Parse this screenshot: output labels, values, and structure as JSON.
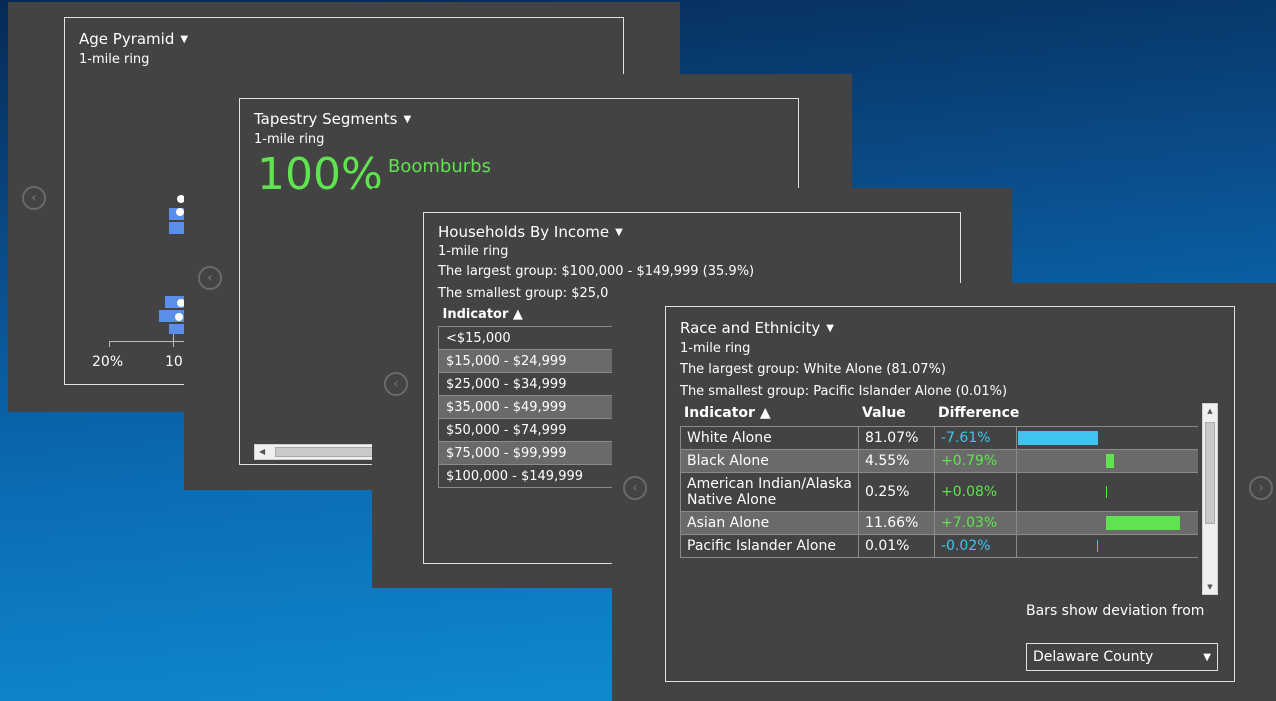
{
  "age_pyramid": {
    "title": "Age Pyramid",
    "subtitle": "1-mile ring",
    "axis_ticks": [
      "20%",
      "10"
    ]
  },
  "tapestry": {
    "title": "Tapestry Segments",
    "subtitle": "1-mile ring",
    "percent": "100%",
    "segment": "Boomburbs"
  },
  "income": {
    "title": "Households By Income",
    "subtitle": "1-mile ring",
    "largest": "The largest group: $100,000 - $149,999 (35.9%)",
    "smallest": "The smallest group: $25,0",
    "header_indicator": "Indicator ▲",
    "rows": [
      "<$15,000",
      "$15,000 - $24,999",
      "$25,000 - $34,999",
      "$35,000 - $49,999",
      "$50,000 - $74,999",
      "$75,000 - $99,999",
      "$100,000 - $149,999"
    ]
  },
  "race": {
    "title": "Race and Ethnicity",
    "subtitle": "1-mile ring",
    "largest": "The largest group: White Alone (81.07%)",
    "smallest": "The smallest group: Pacific Islander Alone (0.01%)",
    "headers": {
      "indicator": "Indicator ▲",
      "value": "Value",
      "difference": "Difference"
    },
    "rows": [
      {
        "indicator": "White Alone",
        "value": "81.07%",
        "difference": "-7.61%",
        "deviation": -7.61
      },
      {
        "indicator": "Black Alone",
        "value": "4.55%",
        "difference": "+0.79%",
        "deviation": 0.79
      },
      {
        "indicator": "American Indian/Alaska Native Alone",
        "value": "0.25%",
        "difference": "+0.08%",
        "deviation": 0.08
      },
      {
        "indicator": "Asian Alone",
        "value": "11.66%",
        "difference": "+7.03%",
        "deviation": 7.03
      },
      {
        "indicator": "Pacific Islander Alone",
        "value": "0.01%",
        "difference": "-0.02%",
        "deviation": -0.02
      }
    ],
    "deviation_label": "Bars show deviation from",
    "deviation_select": "Delaware County"
  },
  "nav": {
    "prev": "‹",
    "next": "›"
  },
  "colors": {
    "positive": "#5fe34f",
    "negative": "#3fc4f0",
    "bar_blue": "#5b8ee8"
  }
}
